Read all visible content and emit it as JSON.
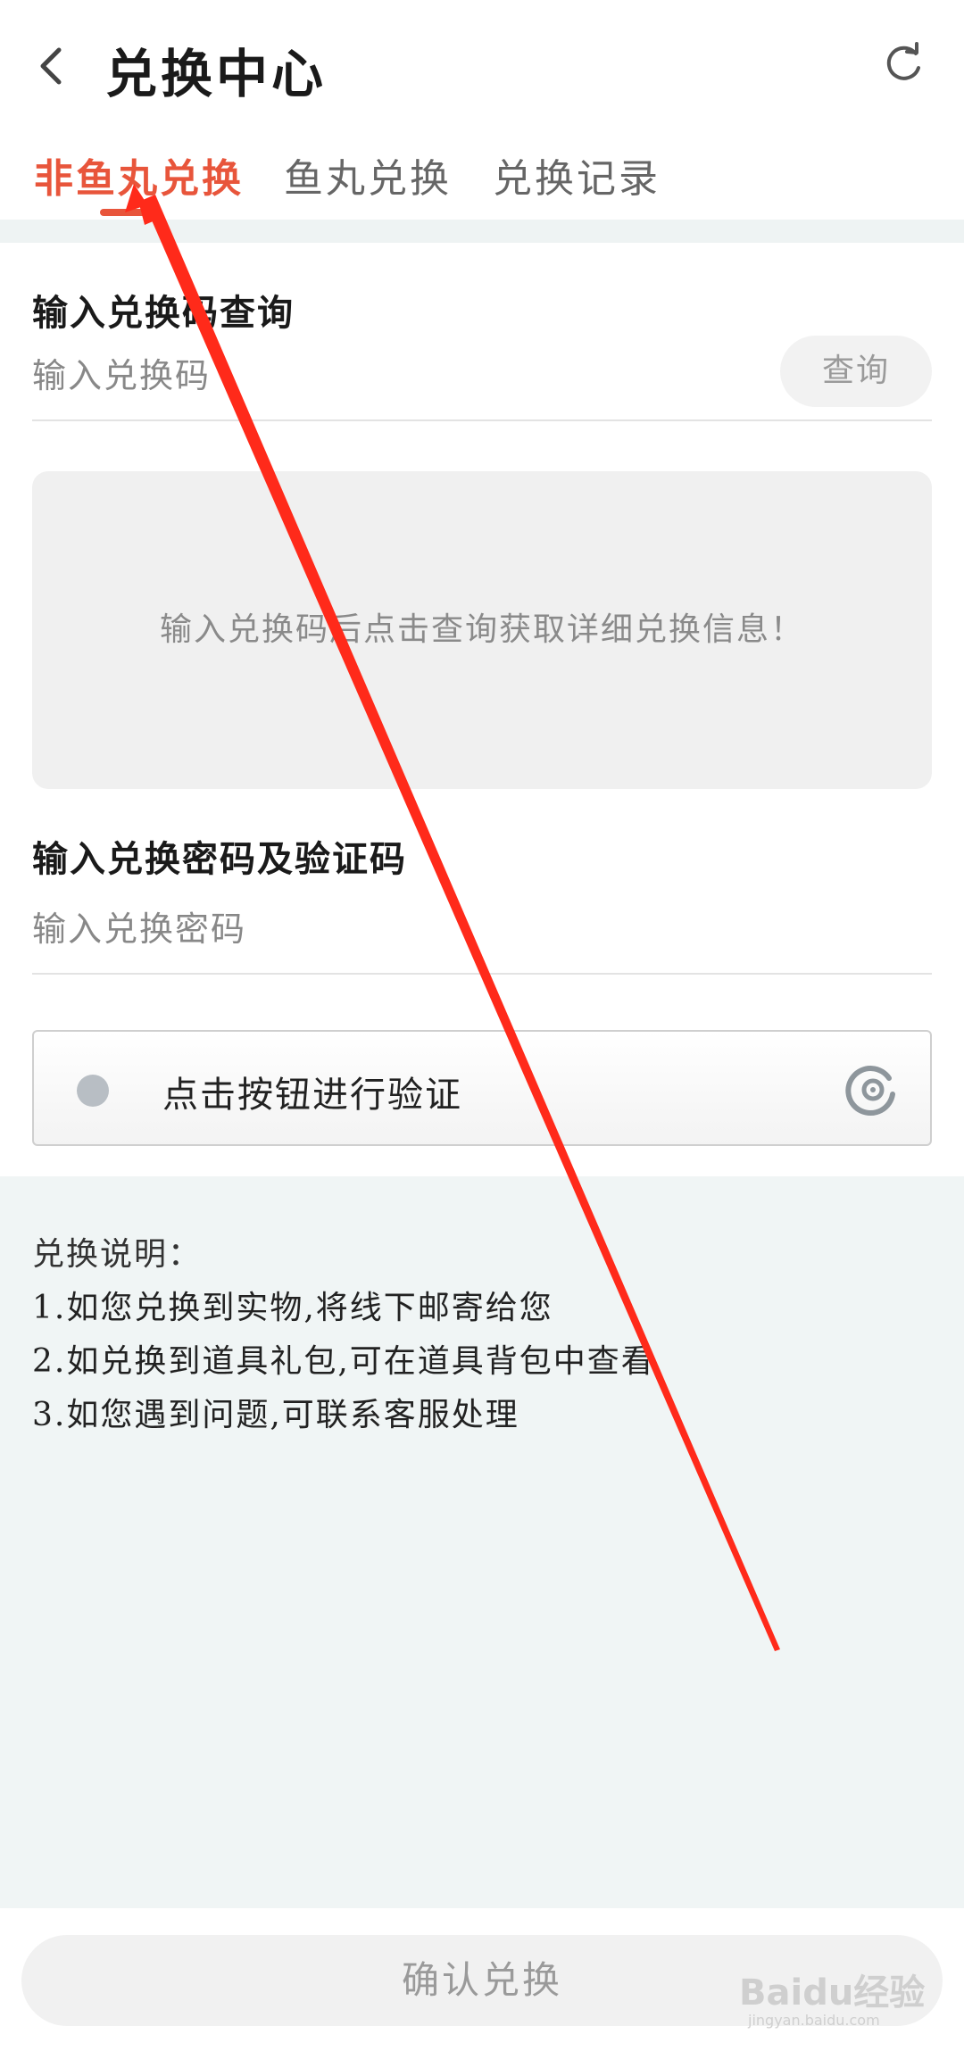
{
  "header": {
    "title": "兑换中心",
    "back_icon": "chevron-left-icon",
    "refresh_icon": "refresh-icon"
  },
  "tabs": [
    {
      "label": "非鱼丸兑换",
      "active": true
    },
    {
      "label": "鱼丸兑换",
      "active": false
    },
    {
      "label": "兑换记录",
      "active": false
    }
  ],
  "code_query": {
    "title": "输入兑换码查询",
    "placeholder": "输入兑换码",
    "button_label": "查询",
    "info_text": "输入兑换码后点击查询获取详细兑换信息！"
  },
  "password_section": {
    "title": "输入兑换密码及验证码",
    "placeholder": "输入兑换密码"
  },
  "verify": {
    "label": "点击按钮进行验证"
  },
  "notes": {
    "title": "兑换说明：",
    "items": [
      "1.如您兑换到实物,将线下邮寄给您",
      "2.如兑换到道具礼包,可在道具背包中查看",
      "3.如您遇到问题,可联系客服处理"
    ]
  },
  "footer": {
    "confirm_label": "确认兑换",
    "watermark": "Baidu经验",
    "watermark_sub": "jingyan.baidu.com"
  },
  "colors": {
    "accent": "#e8553b",
    "annotation_arrow": "#ff2a1a",
    "notes_background": "#f0f5f5"
  }
}
